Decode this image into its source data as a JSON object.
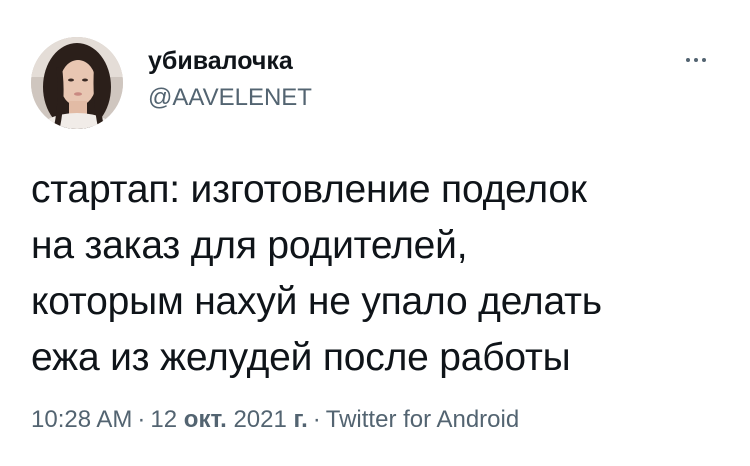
{
  "author": {
    "display_name": "убивалочка",
    "handle": "@AAVELENET"
  },
  "tweet": {
    "lines": [
      "стартап: изготовление поделок",
      "на заказ для родителей,",
      "которым нахуй не упало делать",
      "ежа из желудей после работы"
    ]
  },
  "meta": {
    "time": "10:28 AM",
    "separator": "·",
    "day": "12",
    "month": "окт.",
    "year": "2021",
    "year_suffix": "г.",
    "source": "Twitter for Android"
  },
  "icons": {
    "more": "more-horizontal-icon"
  },
  "colors": {
    "text": "#0f1419",
    "secondary": "#536471",
    "background": "#ffffff"
  }
}
